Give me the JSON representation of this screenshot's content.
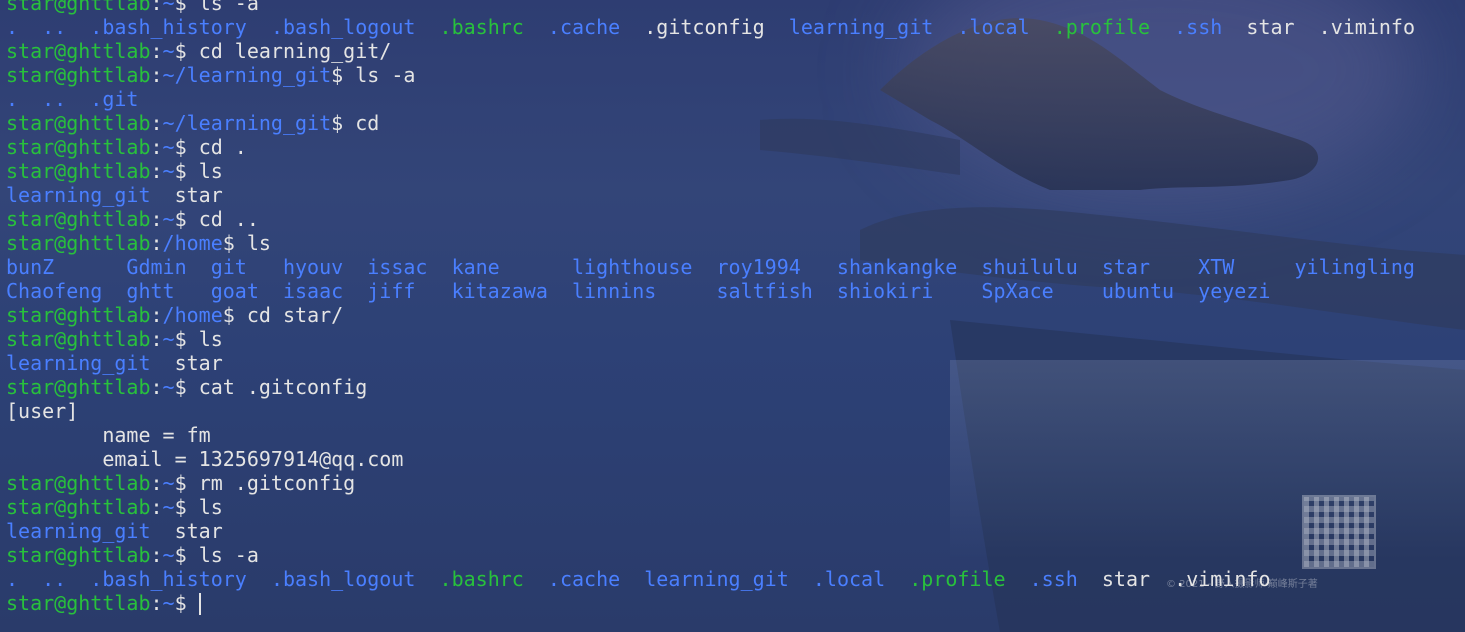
{
  "prompt": {
    "user_host": "star@ghttlab",
    "home_path": "~",
    "repo_path": "~/learning_git",
    "root_home": "/home"
  },
  "colors": {
    "user_host": "#28c13c",
    "path": "#4a7fff",
    "directory": "#4a7fff",
    "hidden_dir": "#28c13c",
    "plain_text": "#e4e4e4"
  },
  "watermark": "© 2021 - 野人摄影师·巅峰斯子著",
  "lines": [
    {
      "type": "prompt",
      "path": "~",
      "cmd": "ls -a"
    },
    {
      "type": "output",
      "segments": [
        {
          "t": ".  ..  ",
          "c": "d"
        },
        {
          "t": ".bash_history",
          "c": "d"
        },
        {
          "t": "  "
        },
        {
          "t": ".bash_logout",
          "c": "d"
        },
        {
          "t": "  "
        },
        {
          "t": ".bashrc",
          "c": "g"
        },
        {
          "t": "  "
        },
        {
          "t": ".cache",
          "c": "d"
        },
        {
          "t": "  "
        },
        {
          "t": ".gitconfig"
        },
        {
          "t": "  "
        },
        {
          "t": "learning_git",
          "c": "d"
        },
        {
          "t": "  "
        },
        {
          "t": ".local",
          "c": "d"
        },
        {
          "t": "  "
        },
        {
          "t": ".profile",
          "c": "g"
        },
        {
          "t": "  "
        },
        {
          "t": ".ssh",
          "c": "d"
        },
        {
          "t": "  "
        },
        {
          "t": "star"
        },
        {
          "t": "  "
        },
        {
          "t": ".viminfo"
        }
      ]
    },
    {
      "type": "prompt",
      "path": "~",
      "cmd": "cd learning_git/"
    },
    {
      "type": "prompt",
      "path": "~/learning_git",
      "cmd": "ls -a"
    },
    {
      "type": "output",
      "segments": [
        {
          "t": ".  ..  ",
          "c": "d"
        },
        {
          "t": ".git",
          "c": "d"
        }
      ]
    },
    {
      "type": "prompt",
      "path": "~/learning_git",
      "cmd": "cd"
    },
    {
      "type": "prompt",
      "path": "~",
      "cmd": "cd ."
    },
    {
      "type": "prompt",
      "path": "~",
      "cmd": "ls"
    },
    {
      "type": "output",
      "segments": [
        {
          "t": "learning_git",
          "c": "d"
        },
        {
          "t": "  star"
        }
      ]
    },
    {
      "type": "prompt",
      "path": "~",
      "cmd": "cd .."
    },
    {
      "type": "prompt",
      "path": "/home",
      "cmd": "ls"
    },
    {
      "type": "output",
      "segments": [
        {
          "t": "bunZ      ",
          "c": "d"
        },
        {
          "t": "Gdmin  ",
          "c": "d"
        },
        {
          "t": "git   ",
          "c": "d"
        },
        {
          "t": "hyouv  ",
          "c": "d"
        },
        {
          "t": "issac  ",
          "c": "d"
        },
        {
          "t": "kane      ",
          "c": "d"
        },
        {
          "t": "lighthouse  ",
          "c": "d"
        },
        {
          "t": "roy1994   ",
          "c": "d"
        },
        {
          "t": "shankangke  ",
          "c": "d"
        },
        {
          "t": "shuilulu  ",
          "c": "d"
        },
        {
          "t": "star    ",
          "c": "d"
        },
        {
          "t": "XTW     ",
          "c": "d"
        },
        {
          "t": "yilingling",
          "c": "d"
        }
      ]
    },
    {
      "type": "output",
      "segments": [
        {
          "t": "Chaofeng  ",
          "c": "d"
        },
        {
          "t": "ghtt   ",
          "c": "d"
        },
        {
          "t": "goat  ",
          "c": "d"
        },
        {
          "t": "isaac  ",
          "c": "d"
        },
        {
          "t": "jiff   ",
          "c": "d"
        },
        {
          "t": "kitazawa  ",
          "c": "d"
        },
        {
          "t": "linnins     ",
          "c": "d"
        },
        {
          "t": "saltfish  ",
          "c": "d"
        },
        {
          "t": "shiokiri    ",
          "c": "d"
        },
        {
          "t": "SpXace    ",
          "c": "d"
        },
        {
          "t": "ubuntu  ",
          "c": "d"
        },
        {
          "t": "yeyezi",
          "c": "d"
        }
      ]
    },
    {
      "type": "prompt",
      "path": "/home",
      "cmd": "cd star/"
    },
    {
      "type": "prompt",
      "path": "~",
      "cmd": "ls"
    },
    {
      "type": "output",
      "segments": [
        {
          "t": "learning_git",
          "c": "d"
        },
        {
          "t": "  star"
        }
      ]
    },
    {
      "type": "prompt",
      "path": "~",
      "cmd": "cat .gitconfig"
    },
    {
      "type": "output",
      "segments": [
        {
          "t": "[user]"
        }
      ]
    },
    {
      "type": "output",
      "segments": [
        {
          "t": "        name = fm"
        }
      ]
    },
    {
      "type": "output",
      "segments": [
        {
          "t": "        email = 1325697914@qq.com"
        }
      ]
    },
    {
      "type": "prompt",
      "path": "~",
      "cmd": "rm .gitconfig"
    },
    {
      "type": "prompt",
      "path": "~",
      "cmd": "ls"
    },
    {
      "type": "output",
      "segments": [
        {
          "t": "learning_git",
          "c": "d"
        },
        {
          "t": "  star"
        }
      ]
    },
    {
      "type": "prompt",
      "path": "~",
      "cmd": "ls -a"
    },
    {
      "type": "output",
      "segments": [
        {
          "t": ".  ..  ",
          "c": "d"
        },
        {
          "t": ".bash_history",
          "c": "d"
        },
        {
          "t": "  "
        },
        {
          "t": ".bash_logout",
          "c": "d"
        },
        {
          "t": "  "
        },
        {
          "t": ".bashrc",
          "c": "g"
        },
        {
          "t": "  "
        },
        {
          "t": ".cache",
          "c": "d"
        },
        {
          "t": "  "
        },
        {
          "t": "learning_git",
          "c": "d"
        },
        {
          "t": "  "
        },
        {
          "t": ".local",
          "c": "d"
        },
        {
          "t": "  "
        },
        {
          "t": ".profile",
          "c": "g"
        },
        {
          "t": "  "
        },
        {
          "t": ".ssh",
          "c": "d"
        },
        {
          "t": "  "
        },
        {
          "t": "star"
        },
        {
          "t": "  "
        },
        {
          "t": ".viminfo"
        }
      ]
    },
    {
      "type": "prompt",
      "path": "~",
      "cmd": "",
      "cursor": true
    }
  ]
}
